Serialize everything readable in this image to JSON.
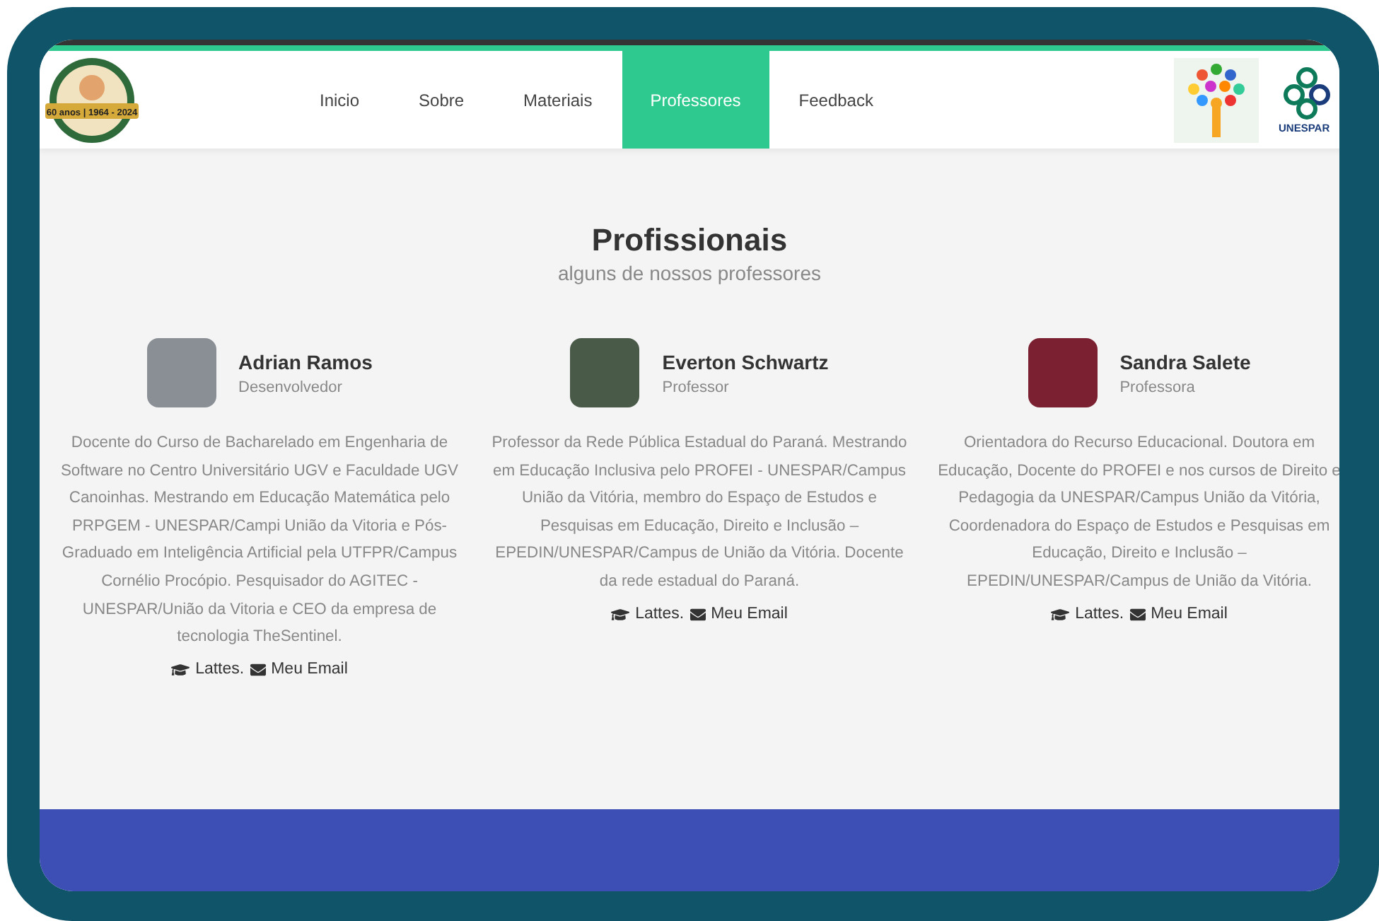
{
  "logo": {
    "badge": "60 anos | 1964 - 2024"
  },
  "nav": [
    {
      "label": "Inicio",
      "selected": false
    },
    {
      "label": "Sobre",
      "selected": false
    },
    {
      "label": "Materiais",
      "selected": false
    },
    {
      "label": "Professores",
      "selected": true
    },
    {
      "label": "Feedback",
      "selected": false
    }
  ],
  "partner_logo": {
    "text": "UNESPAR"
  },
  "section": {
    "title": "Profissionais",
    "subtitle": "alguns de nossos professores"
  },
  "professors": [
    {
      "name": "Adrian Ramos",
      "role": "Desenvolvedor",
      "bio": "Docente do Curso de Bacharelado em Engenharia de Software no Centro Universitário UGV e Faculdade UGV Canoinhas. Mestrando em Educação Matemática pelo PRPGEM - UNESPAR/Campi União da Vitoria e Pós-Graduado em Inteligência Artificial pela UTFPR/Campus Cornélio Procópio. Pesquisador do AGITEC - UNESPAR/União da Vitoria e CEO da empresa de tecnologia TheSentinel.",
      "lattes": "Lattes.",
      "email": "Meu Email"
    },
    {
      "name": "Everton Schwartz",
      "role": "Professor",
      "bio": "Professor da Rede Pública Estadual do Paraná. Mestrando em Educação Inclusiva pelo PROFEI - UNESPAR/Campus União da Vitória, membro do Espaço de Estudos e Pesquisas em Educação, Direito e Inclusão – EPEDIN/UNESPAR/Campus de União da Vitória. Docente da rede estadual do Paraná.",
      "lattes": "Lattes.",
      "email": "Meu Email"
    },
    {
      "name": "Sandra Salete",
      "role": "Professora",
      "bio": "Orientadora do Recurso Educacional. Doutora em Educação, Docente do PROFEI e nos cursos de Direito e Pedagogia da UNESPAR/Campus União da Vitória, Coordenadora do Espaço de Estudos e Pesquisas em Educação, Direito e Inclusão – EPEDIN/UNESPAR/Campus de União da Vitória.",
      "lattes": "Lattes.",
      "email": "Meu Email"
    }
  ]
}
